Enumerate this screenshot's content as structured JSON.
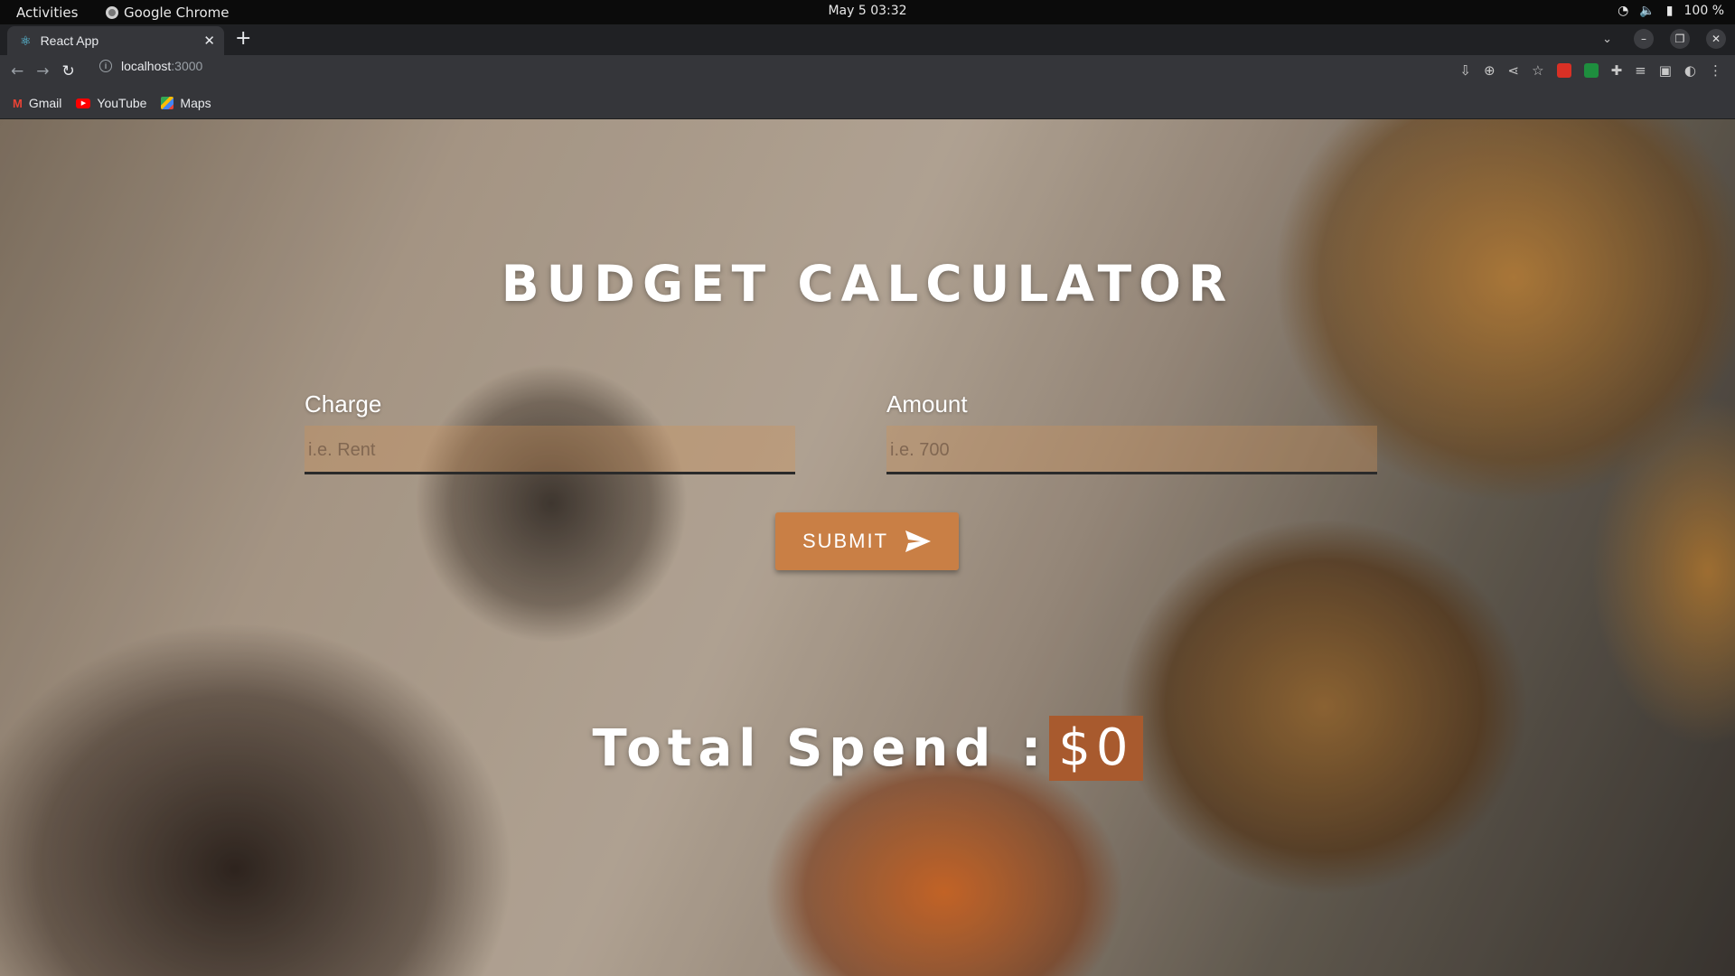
{
  "os": {
    "activities": "Activities",
    "app_name": "Google Chrome",
    "clock": "May 5  03:32",
    "battery": "100 %"
  },
  "browser": {
    "tab_title": "React App",
    "url_host": "localhost",
    "url_port": ":3000",
    "bookmarks": [
      {
        "label": "Gmail",
        "icon": "gmail-icon"
      },
      {
        "label": "YouTube",
        "icon": "youtube-icon"
      },
      {
        "label": "Maps",
        "icon": "maps-icon"
      }
    ]
  },
  "app": {
    "title": "BUDGET CALCULATOR",
    "charge": {
      "label": "Charge",
      "value": "",
      "placeholder": "i.e. Rent"
    },
    "amount": {
      "label": "Amount",
      "value": "",
      "placeholder": "i.e. 700"
    },
    "submit_label": "SUBMIT",
    "total_label": "Total Spend :",
    "total_value": "$0"
  },
  "colors": {
    "button": "#c97f45",
    "total_value_bg": "#a85a2e",
    "input_bg": "rgba(205,145,90,0.35)"
  }
}
